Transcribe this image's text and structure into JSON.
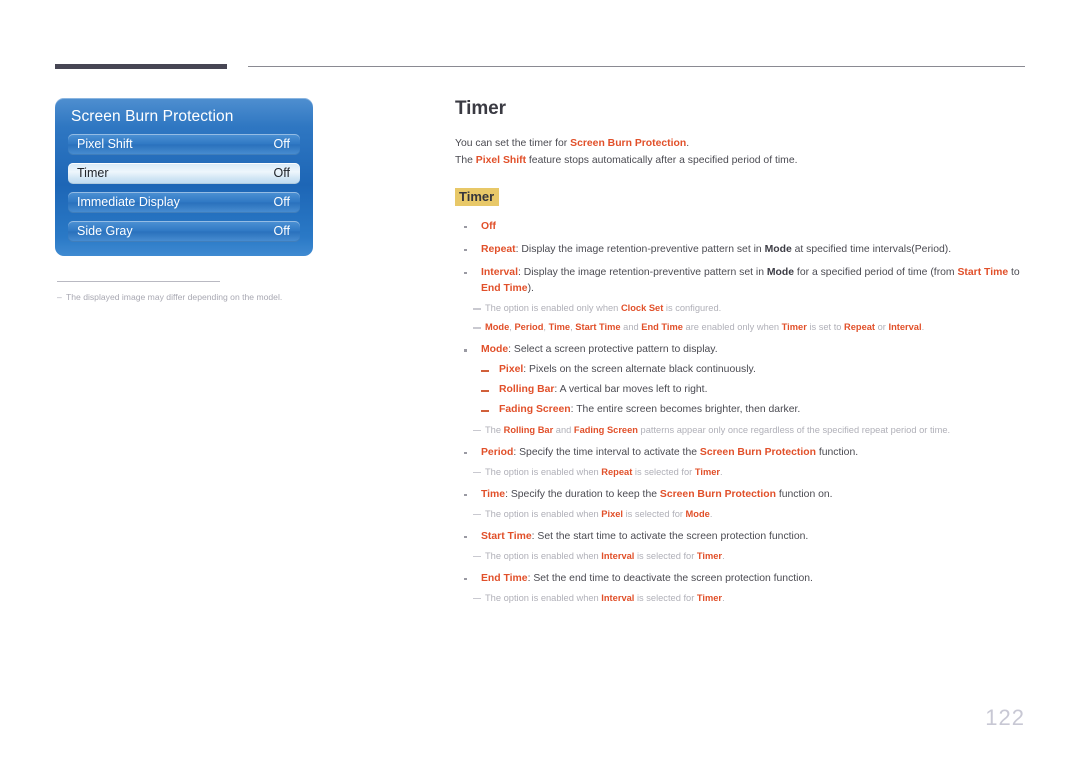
{
  "header": {
    "rule_left_color": "#474654",
    "rule_right_color": "#8a8a92"
  },
  "osd": {
    "title": "Screen Burn Protection",
    "rows": [
      {
        "label": "Pixel Shift",
        "value": "Off",
        "selected": false
      },
      {
        "label": "Timer",
        "value": "Off",
        "selected": true
      },
      {
        "label": "Immediate Display",
        "value": "Off",
        "selected": false
      },
      {
        "label": "Side Gray",
        "value": "Off",
        "selected": false
      }
    ],
    "footnote_dash": "–",
    "footnote": "The displayed image may differ depending on the model."
  },
  "content": {
    "title": "Timer",
    "intro_1_a": "You can set the timer for ",
    "intro_1_b": "Screen Burn Protection",
    "intro_1_c": ".",
    "intro_2_a": "The ",
    "intro_2_b": "Pixel Shift",
    "intro_2_c": " feature stops automatically after a specified period of time.",
    "section_head": "Timer",
    "items": {
      "off": "Off",
      "repeat_label": "Repeat",
      "repeat_text_a": ": Display the image retention-preventive pattern set in ",
      "repeat_mode": "Mode",
      "repeat_text_b": " at specified time intervals(Period).",
      "interval_label": "Interval",
      "interval_text_a": ": Display the image retention-preventive pattern set in ",
      "interval_mode": "Mode",
      "interval_text_b": " for a specified period of time (from ",
      "interval_start": "Start Time",
      "interval_text_c": " to ",
      "interval_end": "End Time",
      "interval_text_d": ").",
      "note_clock_a": "The option is enabled only when ",
      "note_clock_b": "Clock Set",
      "note_clock_c": " is configured.",
      "note_enabled_mode": "Mode",
      "note_enabled_s1": ", ",
      "note_enabled_period": "Period",
      "note_enabled_s2": ", ",
      "note_enabled_time": "Time",
      "note_enabled_s3": ", ",
      "note_enabled_start": "Start Time",
      "note_enabled_s4": " and ",
      "note_enabled_end": "End Time",
      "note_enabled_s5": " are enabled only when ",
      "note_enabled_timer": "Timer",
      "note_enabled_s6": " is set to ",
      "note_enabled_repeat": "Repeat",
      "note_enabled_s7": " or ",
      "note_enabled_interval": "Interval",
      "note_enabled_s8": ".",
      "mode_label": "Mode",
      "mode_text": ": Select a screen protective pattern to display.",
      "pixel_label": "Pixel",
      "pixel_text": ": Pixels on the screen alternate black continuously.",
      "rollingbar_label": "Rolling Bar",
      "rollingbar_text": ": A vertical bar moves left to right.",
      "fading_label": "Fading Screen",
      "fading_text": ": The entire screen becomes brighter, then darker.",
      "note_patterns_a": "The ",
      "note_patterns_b": "Rolling Bar",
      "note_patterns_c": " and ",
      "note_patterns_d": "Fading Screen",
      "note_patterns_e": " patterns appear only once regardless of the specified repeat period or time.",
      "period_label": "Period",
      "period_text_a": ": Specify the time interval to activate the ",
      "period_sbp": "Screen Burn Protection",
      "period_text_b": " function.",
      "note_period_a": "The option is enabled when ",
      "note_period_b": "Repeat",
      "note_period_c": " is selected for ",
      "note_period_d": "Timer",
      "note_period_e": ".",
      "time_label": "Time",
      "time_text_a": ": Specify the duration to keep the ",
      "time_sbp": "Screen Burn Protection",
      "time_text_b": " function on.",
      "note_time_a": "The option is enabled when ",
      "note_time_b": "Pixel",
      "note_time_c": " is selected for ",
      "note_time_d": "Mode",
      "note_time_e": ".",
      "starttime_label": "Start Time",
      "starttime_text": ": Set the start time to activate the screen protection function.",
      "note_start_a": "The option is enabled when ",
      "note_start_b": "Interval",
      "note_start_c": " is selected for ",
      "note_start_d": "Timer",
      "note_start_e": ".",
      "endtime_label": "End Time",
      "endtime_text": ": Set the end time to deactivate the screen protection function.",
      "note_end_a": "The option is enabled when ",
      "note_end_b": "Interval",
      "note_end_c": " is selected for ",
      "note_end_d": "Timer",
      "note_end_e": "."
    }
  },
  "footer": {
    "page_number": "122"
  }
}
